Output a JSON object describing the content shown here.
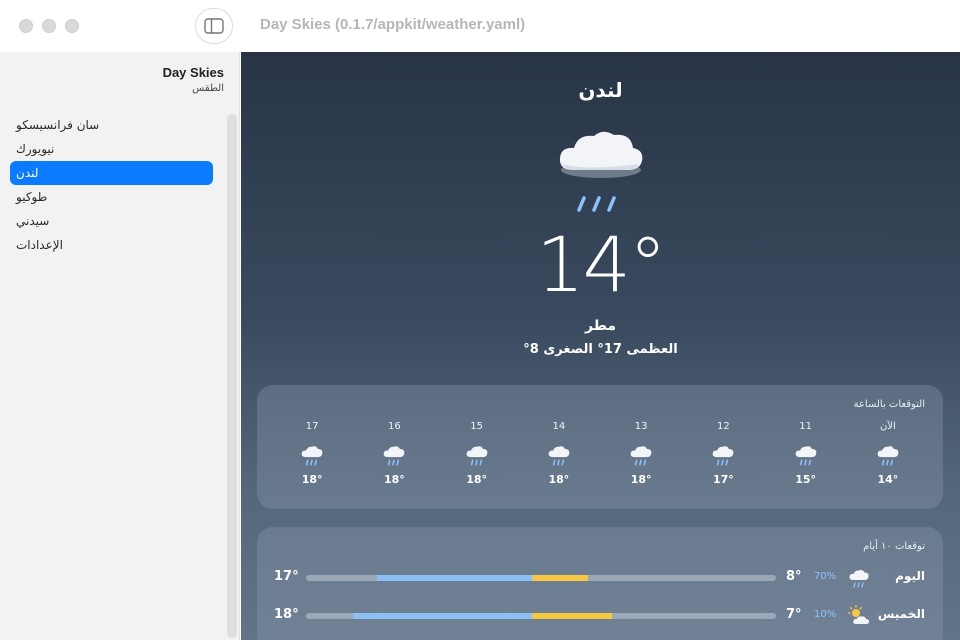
{
  "window": {
    "title": "Day Skies (0.1.7/appkit/weather.yaml)"
  },
  "sidebar": {
    "title": "Day Skies",
    "subtitle": "الطقس",
    "items": [
      {
        "label": "سان فرانسيسكو",
        "active": false
      },
      {
        "label": "نيويورك",
        "active": false
      },
      {
        "label": "لندن",
        "active": true
      },
      {
        "label": "طوكيو",
        "active": false
      },
      {
        "label": "سيدني",
        "active": false
      },
      {
        "label": "الإعدادات",
        "active": false
      }
    ]
  },
  "current": {
    "city": "لندن",
    "icon": "rain-cloud-icon",
    "temperature": "14°",
    "condition": "مطر",
    "high_low": "العظمى 17° الصغرى 8°"
  },
  "hourly": {
    "title": "التوقعات بالساعة",
    "items": [
      {
        "label": "الآن",
        "temp": "14°",
        "icon": "rain-cloud-icon"
      },
      {
        "label": "11",
        "temp": "15°",
        "icon": "rain-cloud-icon"
      },
      {
        "label": "12",
        "temp": "17°",
        "icon": "rain-cloud-icon"
      },
      {
        "label": "13",
        "temp": "18°",
        "icon": "rain-cloud-icon"
      },
      {
        "label": "14",
        "temp": "18°",
        "icon": "rain-cloud-icon"
      },
      {
        "label": "15",
        "temp": "18°",
        "icon": "rain-cloud-icon"
      },
      {
        "label": "16",
        "temp": "18°",
        "icon": "rain-cloud-icon"
      },
      {
        "label": "17",
        "temp": "18°",
        "icon": "rain-cloud-icon"
      }
    ]
  },
  "daily": {
    "title": "توقعات ١٠ أيام",
    "scale_min": 0,
    "scale_max": 20,
    "rows": [
      {
        "day": "اليوم",
        "icon": "rain-cloud-icon",
        "precip": "70%",
        "min": "8°",
        "max": "17°",
        "range_low": 8,
        "range_high": 17
      },
      {
        "day": "الخميس",
        "icon": "partly-cloudy-icon",
        "precip": "10%",
        "min": "7°",
        "max": "18°",
        "range_low": 7,
        "range_high": 18
      }
    ]
  },
  "colors": {
    "accent": "#0a7aff",
    "precip": "#8ec2ff",
    "bar_cool": "#8cc0f4",
    "bar_warm": "#f7c744",
    "background_top": "#283446",
    "background_bottom": "#627488"
  }
}
